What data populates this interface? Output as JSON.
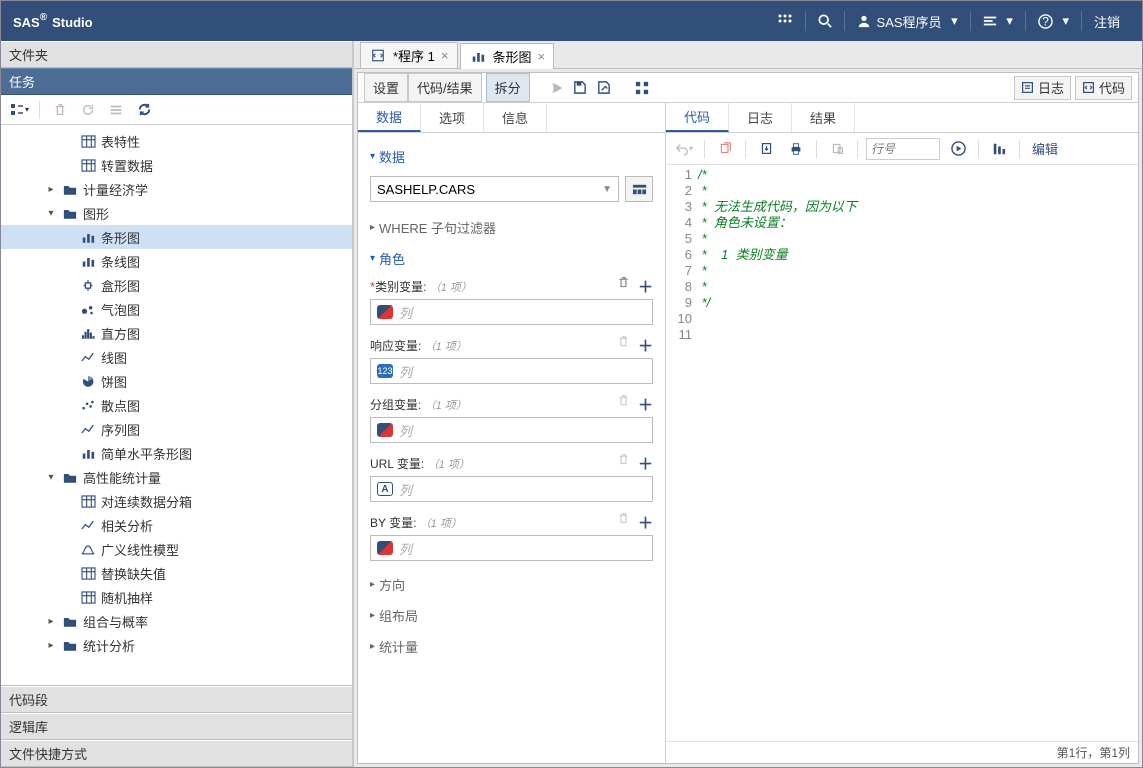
{
  "brand": "SAS",
  "brand_suffix": "Studio",
  "top": {
    "user": "SAS程序员",
    "signout": "注销"
  },
  "left": {
    "folders": "文件夹",
    "tasks": "任务",
    "snippets": "代码段",
    "libraries": "逻辑库",
    "shortcuts": "文件快捷方式"
  },
  "tree": [
    {
      "depth": 3,
      "toggle": "",
      "icon": "tbl",
      "label": "表特性"
    },
    {
      "depth": 3,
      "toggle": "",
      "icon": "tbl",
      "label": "转置数据"
    },
    {
      "depth": 2,
      "toggle": "▸",
      "icon": "fld",
      "label": "计量经济学"
    },
    {
      "depth": 2,
      "toggle": "▾",
      "icon": "fld",
      "label": "图形"
    },
    {
      "depth": 3,
      "toggle": "",
      "icon": "bar",
      "label": "条形图",
      "selected": true
    },
    {
      "depth": 3,
      "toggle": "",
      "icon": "bar",
      "label": "条线图"
    },
    {
      "depth": 3,
      "toggle": "",
      "icon": "box",
      "label": "盒形图"
    },
    {
      "depth": 3,
      "toggle": "",
      "icon": "bub",
      "label": "气泡图"
    },
    {
      "depth": 3,
      "toggle": "",
      "icon": "hist",
      "label": "直方图"
    },
    {
      "depth": 3,
      "toggle": "",
      "icon": "line",
      "label": "线图"
    },
    {
      "depth": 3,
      "toggle": "",
      "icon": "pie",
      "label": "饼图"
    },
    {
      "depth": 3,
      "toggle": "",
      "icon": "scat",
      "label": "散点图"
    },
    {
      "depth": 3,
      "toggle": "",
      "icon": "line",
      "label": "序列图"
    },
    {
      "depth": 3,
      "toggle": "",
      "icon": "bar",
      "label": "简单水平条形图"
    },
    {
      "depth": 2,
      "toggle": "▾",
      "icon": "fld",
      "label": "高性能统计量"
    },
    {
      "depth": 3,
      "toggle": "",
      "icon": "tbl",
      "label": "对连续数据分箱"
    },
    {
      "depth": 3,
      "toggle": "",
      "icon": "line",
      "label": "相关分析"
    },
    {
      "depth": 3,
      "toggle": "",
      "icon": "glm",
      "label": "广义线性模型"
    },
    {
      "depth": 3,
      "toggle": "",
      "icon": "tbl",
      "label": "替换缺失值"
    },
    {
      "depth": 3,
      "toggle": "",
      "icon": "tbl",
      "label": "随机抽样"
    },
    {
      "depth": 2,
      "toggle": "▸",
      "icon": "fld",
      "label": "组合与概率"
    },
    {
      "depth": 2,
      "toggle": "▸",
      "icon": "fld",
      "label": "统计分析"
    }
  ],
  "tabs": [
    {
      "icon": "prg",
      "label": "*程序 1",
      "active": false
    },
    {
      "icon": "bar",
      "label": "条形图",
      "active": true
    }
  ],
  "viewbar": {
    "settings": "设置",
    "coderes": "代码/结果",
    "split": "拆分",
    "log": "日志",
    "code": "代码"
  },
  "leftTabs": {
    "data": "数据",
    "options": "选项",
    "info": "信息"
  },
  "form": {
    "sec_data": "数据",
    "dataset": "SASHELP.CARS",
    "sec_where": "WHERE 子句过滤器",
    "sec_roles": "角色",
    "roles": [
      {
        "name": "类别变量:",
        "cnt": "（1 项）",
        "req": true,
        "pill": "diag",
        "ph": "列"
      },
      {
        "name": "响应变量:",
        "cnt": "（1 项）",
        "req": false,
        "pill": "num",
        "ph": "列"
      },
      {
        "name": "分组变量:",
        "cnt": "（1 项）",
        "req": false,
        "pill": "diag",
        "ph": "列"
      },
      {
        "name": "URL 变量:",
        "cnt": "（1 项）",
        "req": false,
        "pill": "a",
        "ph": "列"
      },
      {
        "name": "BY 变量:",
        "cnt": "（1 项）",
        "req": false,
        "pill": "diag",
        "ph": "列"
      }
    ],
    "sec_direction": "方向",
    "sec_group": "组布局",
    "sec_stat": "统计量"
  },
  "rightTabs": {
    "code": "代码",
    "log": "日志",
    "results": "结果"
  },
  "codetb": {
    "linenum": "行号",
    "edit": "编辑"
  },
  "code": {
    "lines": [
      "/*",
      " *",
      " *  无法生成代码，因为以下",
      " *  角色未设置：",
      " *",
      " *    1  类别变量",
      " *",
      " *",
      " */",
      "",
      ""
    ]
  },
  "status": "第1行，第1列"
}
